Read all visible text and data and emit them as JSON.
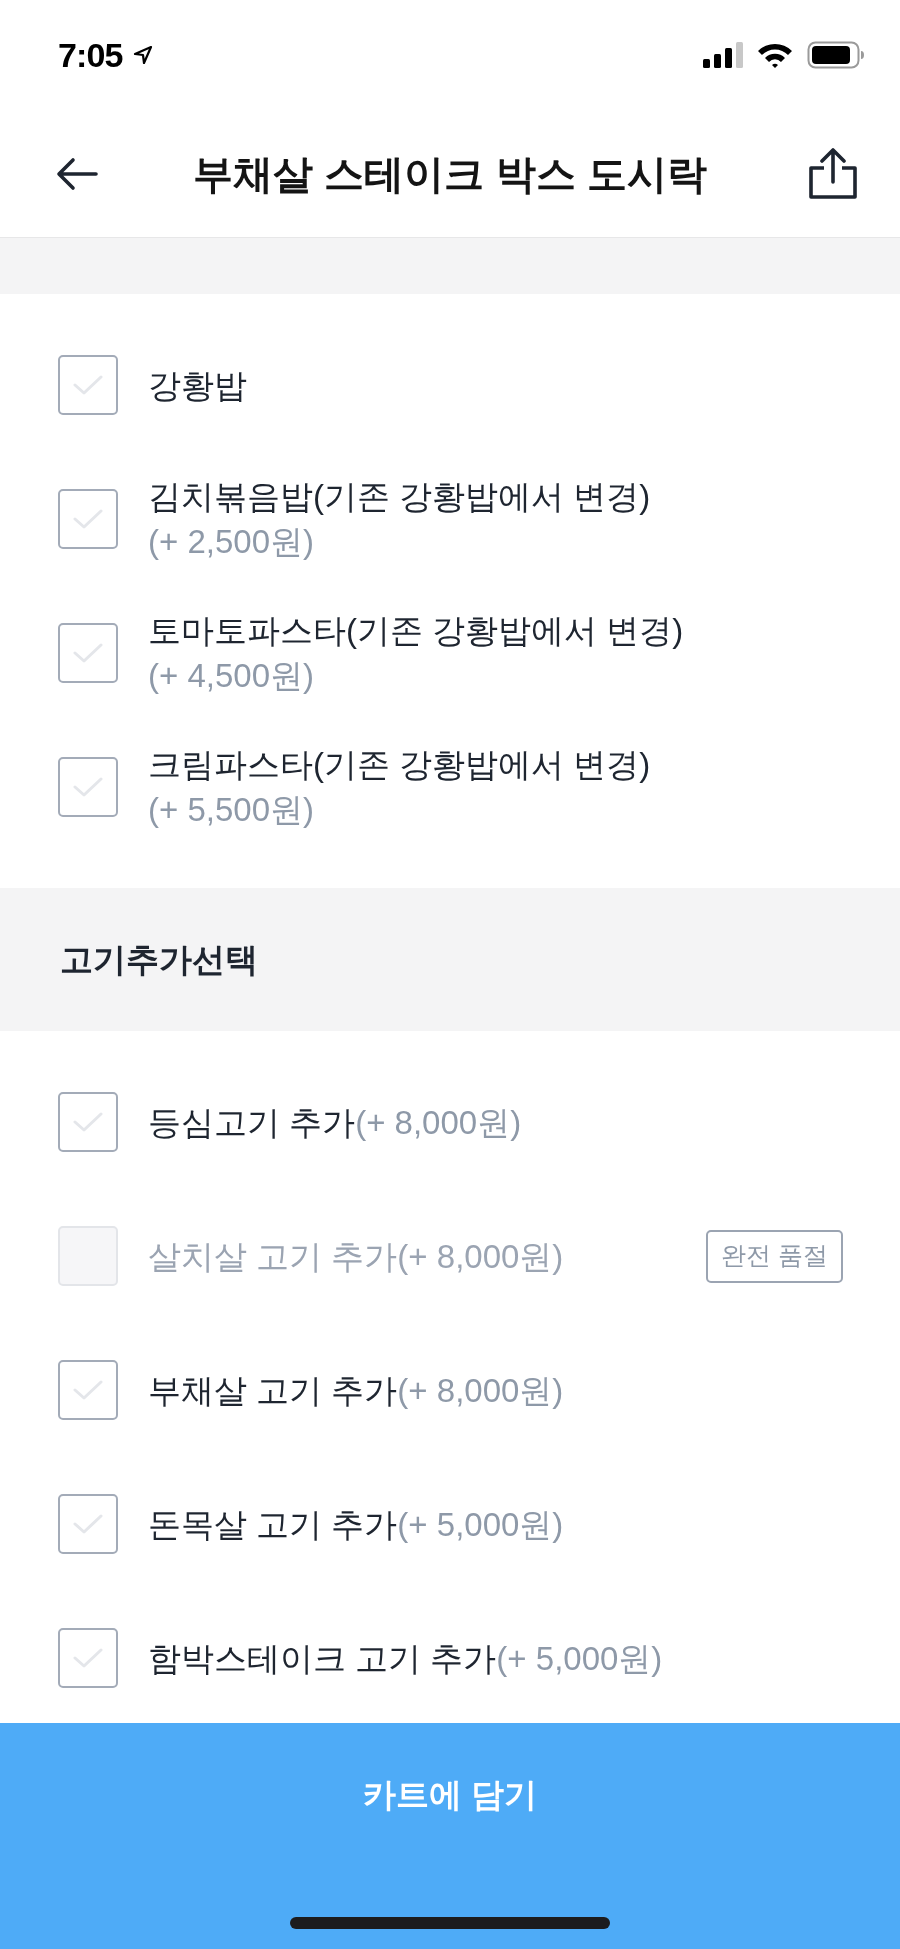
{
  "status_bar": {
    "time": "7:05"
  },
  "header": {
    "title": "부채살 스테이크 박스 도시락"
  },
  "option_groups": [
    {
      "options": [
        {
          "name": "강황밥",
          "checked": false,
          "disabled": false
        },
        {
          "name": "김치볶음밥(기존 강황밥에서 변경)",
          "price": "(+ 2,500원)",
          "checked": false,
          "disabled": false
        },
        {
          "name": "토마토파스타(기존 강황밥에서 변경)",
          "price": "(+ 4,500원)",
          "checked": false,
          "disabled": false
        },
        {
          "name": "크림파스타(기존 강황밥에서 변경)",
          "price": "(+ 5,500원)",
          "checked": false,
          "disabled": false
        }
      ]
    },
    {
      "title": "고기추가선택",
      "options": [
        {
          "name": "등심고기 추가",
          "price": "(+ 8,000원)",
          "checked": false,
          "disabled": false
        },
        {
          "name": "살치살 고기 추가",
          "price": "(+ 8,000원)",
          "checked": false,
          "disabled": true,
          "badge": "완전 품절"
        },
        {
          "name": "부채살 고기 추가",
          "price": "(+ 8,000원)",
          "checked": false,
          "disabled": false
        },
        {
          "name": "돈목살 고기 추가",
          "price": "(+ 5,000원)",
          "checked": false,
          "disabled": false
        },
        {
          "name": "함박스테이크 고기 추가",
          "price": "(+ 5,000원)",
          "checked": false,
          "disabled": false
        }
      ]
    }
  ],
  "cart_button": {
    "label": "카트에 담기"
  }
}
